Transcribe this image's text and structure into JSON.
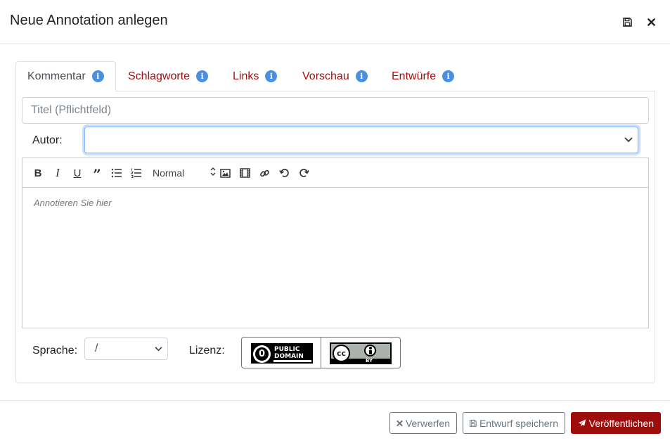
{
  "header": {
    "title": "Neue Annotation anlegen"
  },
  "tabs": [
    {
      "label": "Kommentar",
      "active": true,
      "info": "i"
    },
    {
      "label": "Schlagworte",
      "active": false,
      "info": "i"
    },
    {
      "label": "Links",
      "active": false,
      "info": "i"
    },
    {
      "label": "Vorschau",
      "active": false,
      "info": "i"
    },
    {
      "label": "Entwürfe",
      "active": false,
      "info": "i"
    }
  ],
  "form": {
    "title_placeholder": "Titel (Pflichtfeld)",
    "title_value": "",
    "author_label": "Autor:",
    "author_value": "",
    "language_label": "Sprache:",
    "language_value": "/",
    "license_label": "Lizenz:"
  },
  "editor": {
    "format_value": "Normal",
    "placeholder": "Annotieren Sie hier",
    "toolbar": {
      "bold": "B",
      "italic": "I",
      "underline": "U",
      "quote": "”"
    }
  },
  "licenses": [
    {
      "name": "public-domain",
      "line1": "PUBLIC",
      "line2": "DOMAIN",
      "symbol": "0"
    },
    {
      "name": "cc-by",
      "symbol": "cc",
      "tag": "BY"
    }
  ],
  "footer": {
    "discard_label": "Verwerfen",
    "save_draft_label": "Entwurf speichern",
    "publish_label": "Veröffentlichen"
  },
  "colors": {
    "accent": "#9e0c0c",
    "tab_link": "#a01010",
    "info_badge": "#4a90e2",
    "focus_ring": "#86b7fe"
  },
  "icons": [
    "save-icon",
    "close-icon",
    "info-icon",
    "image-icon",
    "video-icon",
    "link-icon",
    "undo-icon",
    "redo-icon",
    "chevron-down-icon",
    "times-icon",
    "paper-plane-icon"
  ]
}
